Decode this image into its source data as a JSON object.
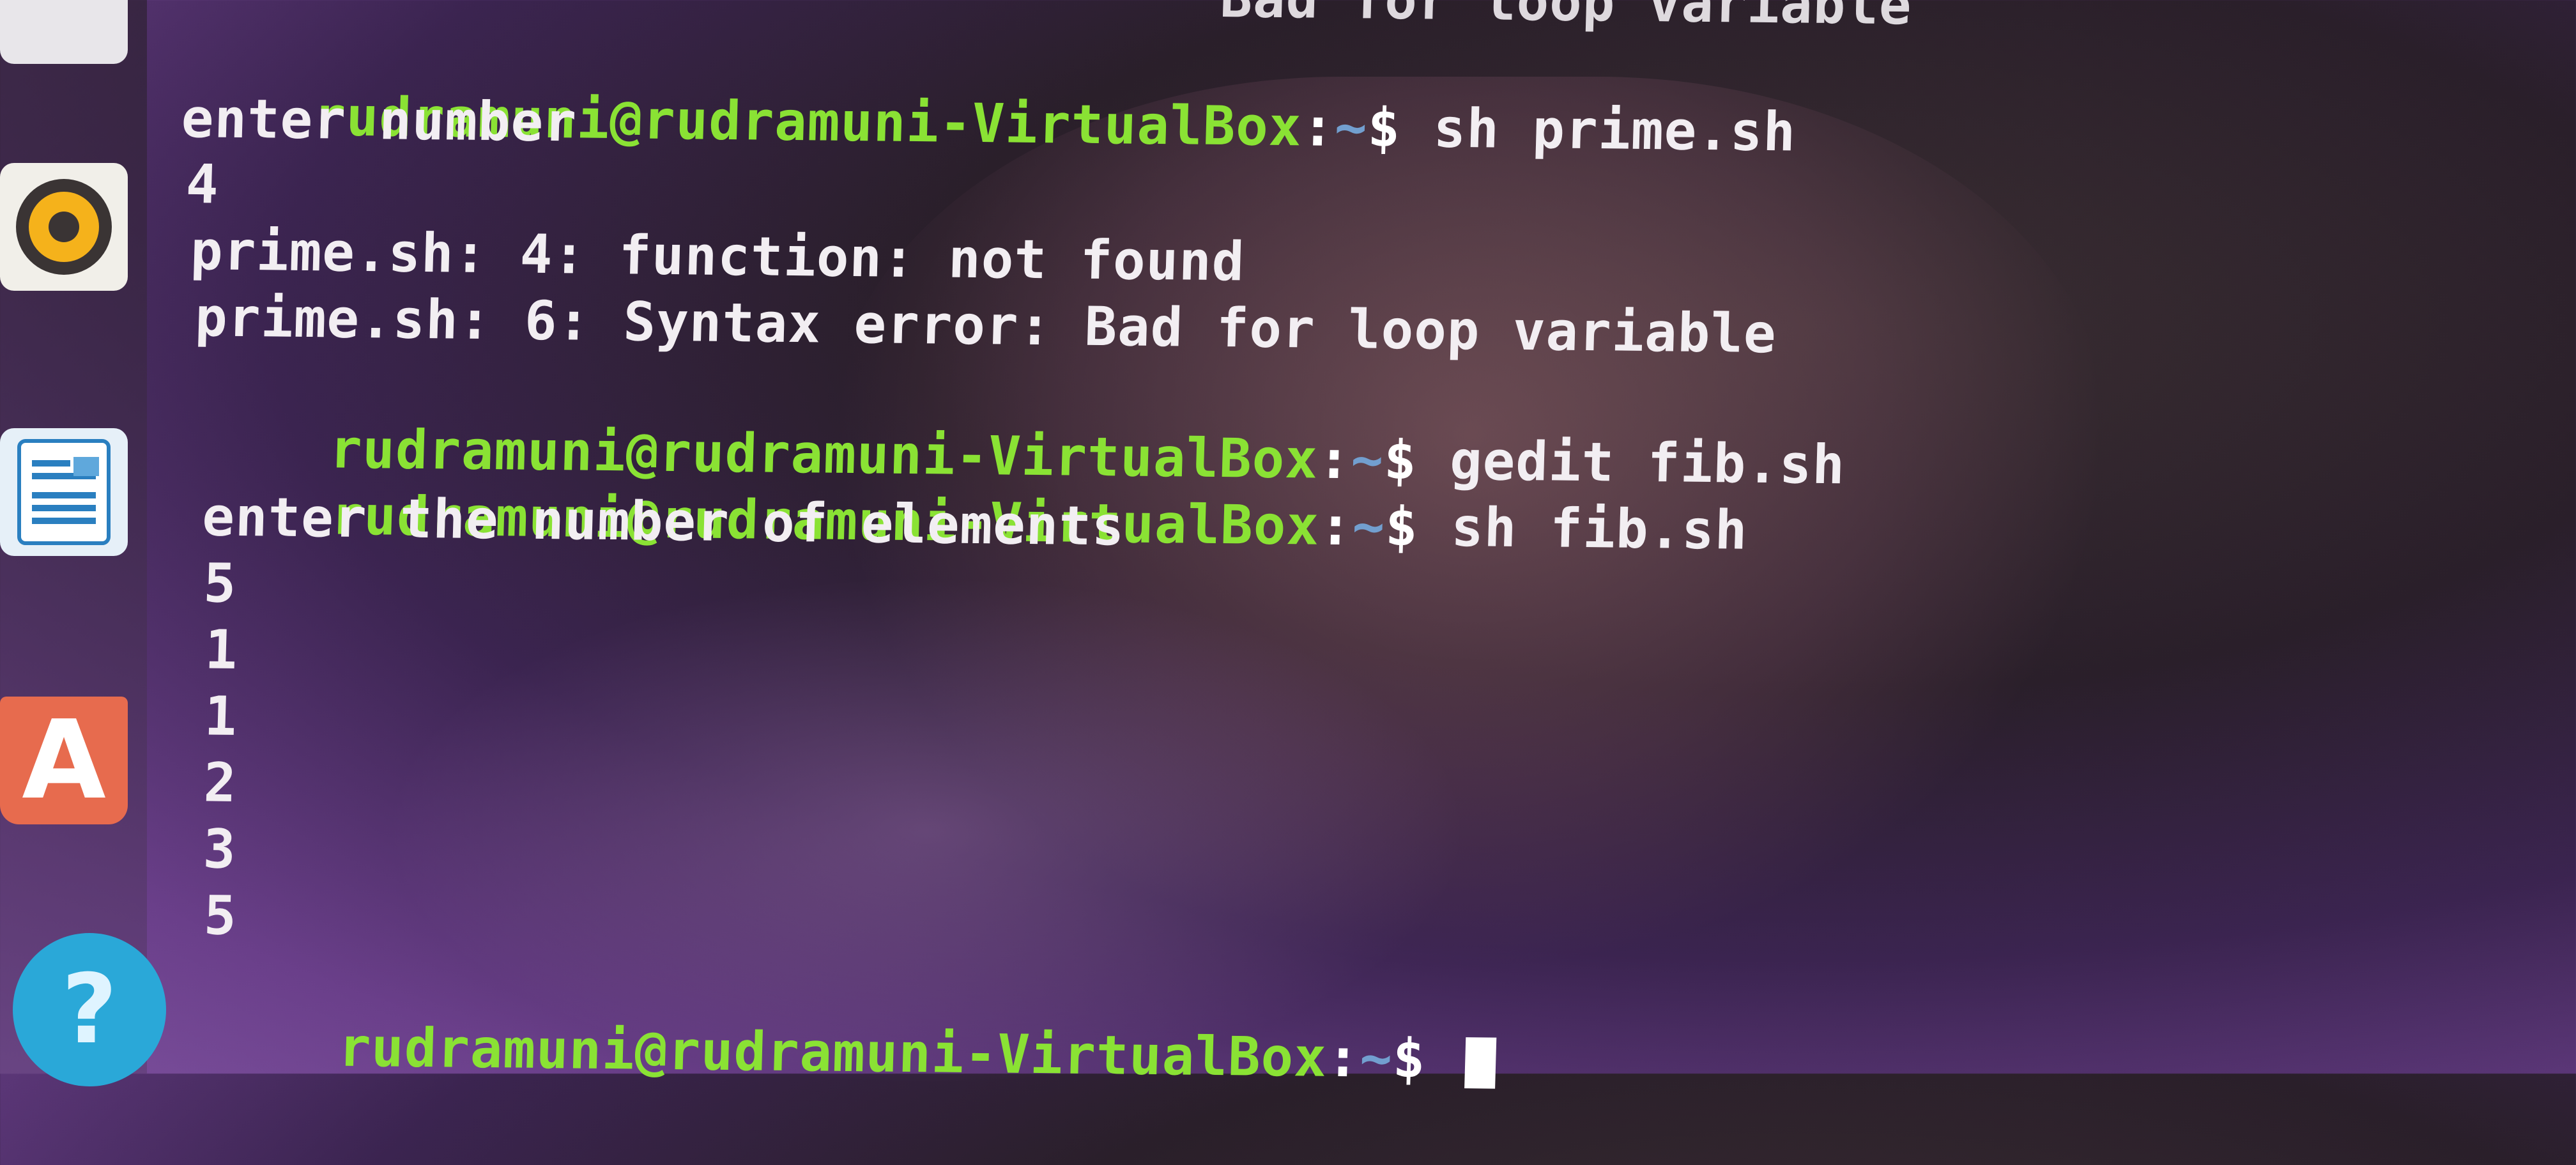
{
  "terminal": {
    "prompt_user": "rudramuni@rudramuni-VirtualBox",
    "prompt_sep": ":",
    "prompt_path": "~",
    "prompt_dollar": "$",
    "partial_top_line": "Bad for loop variable",
    "commands": {
      "cmd1": "sh prime.sh",
      "cmd2": "gedit fib.sh",
      "cmd3": "sh fib.sh"
    },
    "output": {
      "o1": "enter number",
      "o2": "4",
      "o3": "prime.sh: 4: function: not found",
      "o4": "prime.sh: 6: Syntax error: Bad for loop variable",
      "o5": "enter the number of elements",
      "o6": "5",
      "o7": "1",
      "o8": "1",
      "o9": "2",
      "o10": "3",
      "o11": "5"
    }
  },
  "launcher": {
    "icons": [
      "app-icon",
      "rhythmbox-icon",
      "libreoffice-writer-icon",
      "ubuntu-software-icon",
      "help-icon"
    ],
    "software_glyph": "A",
    "help_glyph": "?"
  }
}
